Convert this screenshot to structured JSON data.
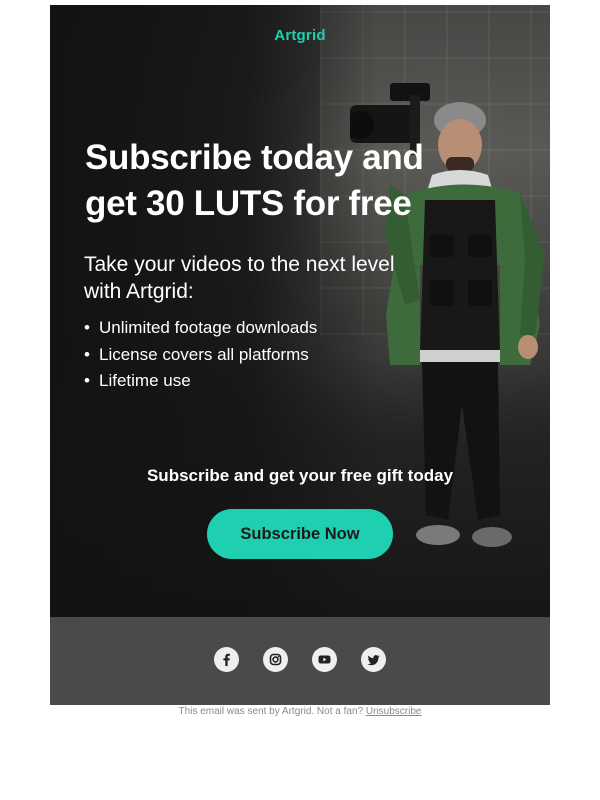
{
  "brand": {
    "logo_text": "Artgrid",
    "accent_color": "#1ecfb0"
  },
  "hero": {
    "headline": "Subscribe today and get 30 LUTS for free",
    "subheading": "Take your videos to the next level with Artgrid:",
    "bullets": [
      "Unlimited footage downloads",
      "License covers all platforms",
      "Lifetime use"
    ],
    "cta_text": "Subscribe and get your free gift today",
    "cta_button_label": "Subscribe Now"
  },
  "footer": {
    "social_icons": [
      "facebook-icon",
      "instagram-icon",
      "youtube-icon",
      "twitter-icon"
    ],
    "fine_print": "This email was sent by Artgrid. Not a fan?",
    "unsubscribe_label": "Unsubscribe"
  }
}
